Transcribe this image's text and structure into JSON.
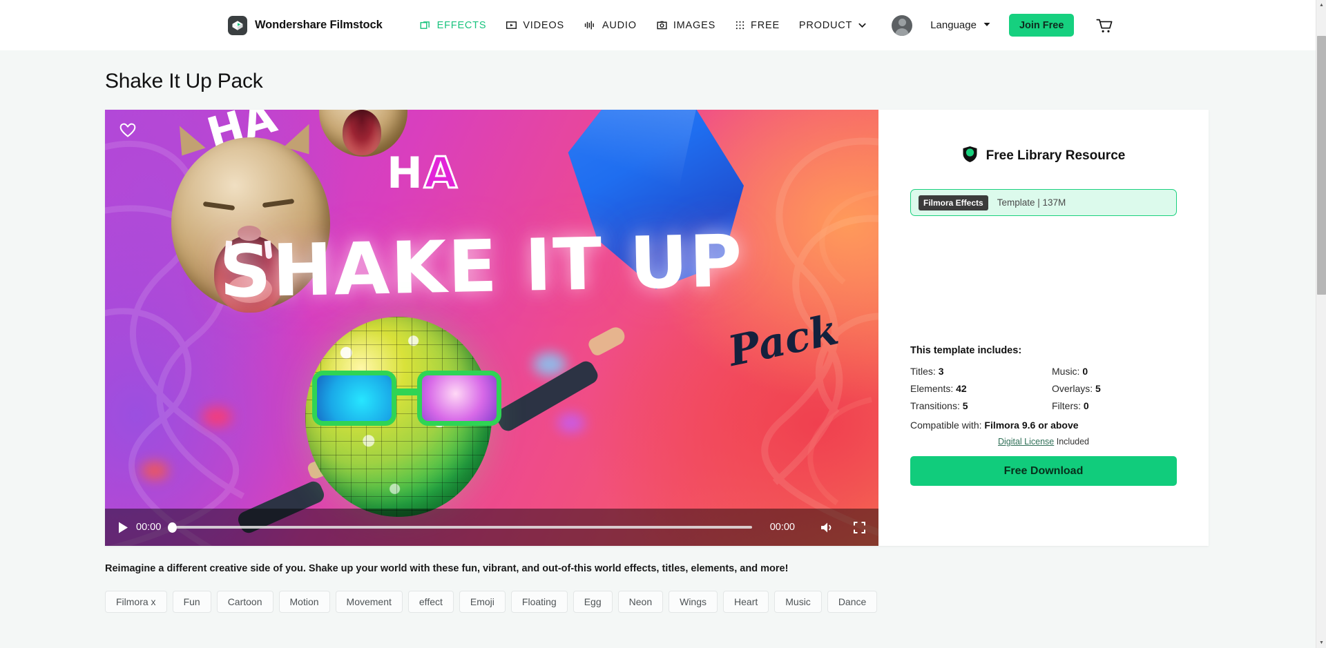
{
  "header": {
    "brand": "Wondershare Filmstock",
    "nav": [
      {
        "label": "EFFECTS",
        "icon": "effects-icon",
        "active": true
      },
      {
        "label": "VIDEOS",
        "icon": "video-icon",
        "active": false
      },
      {
        "label": "AUDIO",
        "icon": "audio-icon",
        "active": false
      },
      {
        "label": "IMAGES",
        "icon": "image-icon",
        "active": false
      },
      {
        "label": "FREE",
        "icon": "grid-dots-icon",
        "active": false
      },
      {
        "label": "PRODUCT",
        "icon": "chevron-down-icon",
        "active": false
      }
    ],
    "language": "Language",
    "join_free": "Join Free",
    "accent_green": "#16d07f"
  },
  "page": {
    "title": "Shake It Up Pack",
    "description": "Reimagine a different creative side of you. Shake up your world with these fun, vibrant, and out-of-this world effects, titles, elements, and more!"
  },
  "video": {
    "poster_headline": "SHAKE IT UP",
    "poster_script": "Pack",
    "poster_ha_1": "HA",
    "poster_ha_2": "HA",
    "current_time": "00:00",
    "duration": "00:00",
    "progress_percent": 0
  },
  "panel": {
    "resource_label": "Free Library Resource",
    "type_tag": "Filmora Effects",
    "type_meta": "Template | 137M",
    "includes_title": "This template includes:",
    "includes": [
      {
        "label": "Titles:",
        "value": "3"
      },
      {
        "label": "Music:",
        "value": "0"
      },
      {
        "label": "Elements:",
        "value": "42"
      },
      {
        "label": "Overlays:",
        "value": "5"
      },
      {
        "label": "Transitions:",
        "value": "5"
      },
      {
        "label": "Filters:",
        "value": "0"
      }
    ],
    "compatible_label": "Compatible with:",
    "compatible_value": "Filmora 9.6 or above",
    "license_link": "Digital License",
    "license_suffix": "Included",
    "download_label": "Free Download",
    "badge_green": "#19d07d"
  },
  "tags": [
    "Filmora x",
    "Fun",
    "Cartoon",
    "Motion",
    "Movement",
    "effect",
    "Emoji",
    "Floating",
    "Egg",
    "Neon",
    "Wings",
    "Heart",
    "Music",
    "Dance"
  ]
}
